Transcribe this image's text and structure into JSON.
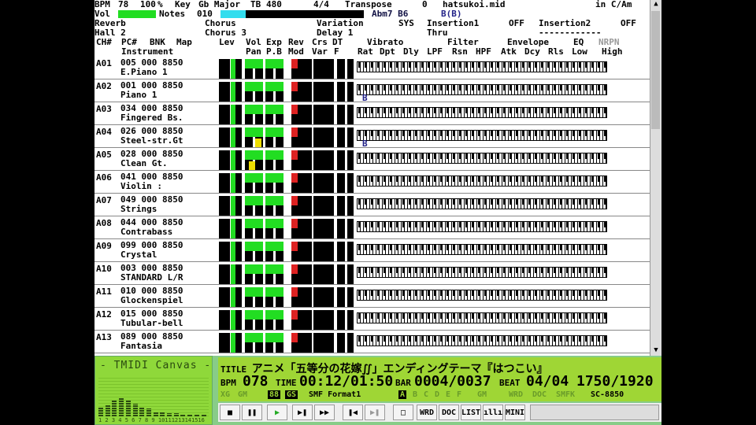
{
  "header": {
    "bpm_label": "BPM",
    "bpm": "78",
    "tempo_pct": "100",
    "pct": "%",
    "key_label": "Key",
    "key": "Gb Major",
    "tb_label": "TB",
    "tb": "480",
    "timesig": "4/4",
    "transpose_label": "Transpose",
    "transpose": "0",
    "filename": "hatsukoi.mid",
    "mode": "in C/Am",
    "vol_label": "Vol",
    "notes_label": "Notes",
    "notes": "010",
    "chord": "Abm7 B6",
    "chord2": "B(B)"
  },
  "effects": {
    "reverb_label": "Reverb",
    "reverb": "Hall 2",
    "chorus_label": "Chorus",
    "chorus": "Chorus 3",
    "variation_label": "Variation",
    "variation": "Delay 1",
    "sys": "SYS",
    "insertion1_label": "Insertion1",
    "insertion1": "OFF",
    "insertion1_val": "Thru",
    "insertion2_label": "Insertion2",
    "insertion2": "OFF",
    "insertion2_val": "------------"
  },
  "columns": {
    "line1": [
      "CH#",
      "PC#",
      "BNK",
      "Map",
      "Lev",
      "Vol",
      "Exp",
      "Rev",
      "Crs",
      "DT",
      "Vibrato",
      "Filter",
      "Envelope",
      "EQ",
      "NRPN"
    ],
    "line2": [
      "Instrument",
      "Pan",
      "P.B",
      "Mod",
      "Var",
      "F",
      "Rat",
      "Dpt",
      "Dly",
      "LPF",
      "Rsn",
      "HPF",
      "Atk",
      "Dcy",
      "Rls",
      "Low",
      "High"
    ]
  },
  "channels": [
    {
      "id": "A01",
      "pc": "005 000 8850",
      "name": "E.Piano 1",
      "marker": "",
      "pan": 0
    },
    {
      "id": "A02",
      "pc": "001 000 8850",
      "name": "Piano 1",
      "marker": "B",
      "pan": 0
    },
    {
      "id": "A03",
      "pc": "034 000 8850",
      "name": "Fingered Bs.",
      "marker": "",
      "pan": 0
    },
    {
      "id": "A04",
      "pc": "026 000 8850",
      "name": "Steel-str.Gt",
      "marker": "B",
      "pan": 1
    },
    {
      "id": "A05",
      "pc": "028 000 8850",
      "name": "Clean Gt.",
      "marker": "",
      "pan": 2
    },
    {
      "id": "A06",
      "pc": "041 000 8850",
      "name": "Violin      :",
      "marker": "",
      "pan": 0
    },
    {
      "id": "A07",
      "pc": "049 000 8850",
      "name": "Strings",
      "marker": "",
      "pan": 0
    },
    {
      "id": "A08",
      "pc": "044 000 8850",
      "name": "Contrabass",
      "marker": "",
      "pan": 0
    },
    {
      "id": "A09",
      "pc": "099 000 8850",
      "name": "Crystal",
      "marker": "",
      "pan": 0
    },
    {
      "id": "A10",
      "pc": "003 000 8850",
      "name": "STANDARD L/R",
      "marker": "",
      "pan": 0
    },
    {
      "id": "A11",
      "pc": "010 000 8850",
      "name": "Glockenspiel",
      "marker": "",
      "pan": 0
    },
    {
      "id": "A12",
      "pc": "015 000 8850",
      "name": "Tubular-bell",
      "marker": "",
      "pan": 0
    },
    {
      "id": "A13",
      "pc": "089 000 8850",
      "name": "Fantasia",
      "marker": "",
      "pan": 0
    }
  ],
  "visualizer": {
    "title": "- TMIDI Canvas -",
    "channels": "1 2 3 4 5 6 7 8 9 10111213141516"
  },
  "lcd": {
    "title_label": "TITLE",
    "title": "アニメ「五等分の花嫁∬」エンディングテーマ『はつこい』",
    "bpm_label": "BPM",
    "bpm": "078",
    "time_label": "TIME",
    "time": "00:12/01:50",
    "bar_label": "BAR",
    "bar": "0004/0037",
    "beat_label": "BEAT",
    "beat": "04/04",
    "tick": "1750/1920",
    "xg": "XG",
    "gm": "GM",
    "num": "88",
    "gs": "GS",
    "format": "SMF Format1",
    "ports": [
      "A",
      "B",
      "C",
      "D",
      "E",
      "F"
    ],
    "ind": [
      "GM",
      "WRD",
      "DOC",
      "SMFK"
    ],
    "device": "SC-8850"
  },
  "controls": {
    "stop": "■",
    "pause": "❚❚",
    "play": "▶",
    "rew": "▶❚",
    "ff": "▶▶",
    "prev": "❚◀",
    "next": "▶❚",
    "window": "□",
    "wrd": "WRD",
    "doc": "DOC",
    "list": "LIST",
    "vis": "ıllı",
    "mini": "MINI"
  }
}
